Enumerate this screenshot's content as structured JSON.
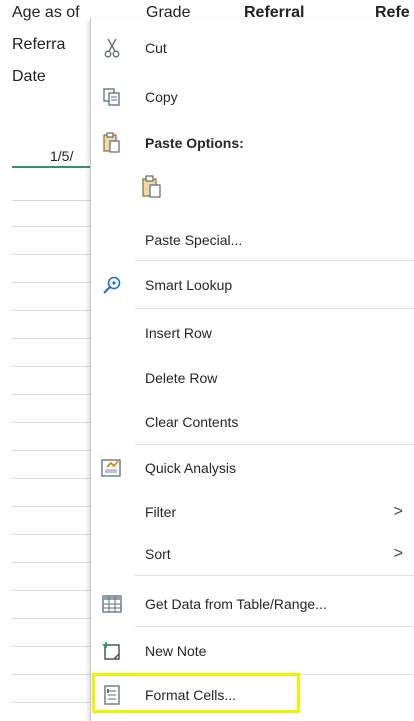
{
  "sheet": {
    "headers": {
      "col1_line1": "Age as of",
      "col1_line2": "Referra",
      "col1_line3": "Date",
      "grade": "Grade",
      "referral": "Referral",
      "referral2": "Refe"
    },
    "first_cell": "1/5/"
  },
  "menu": {
    "cut": "Cut",
    "copy": "Copy",
    "paste_options": "Paste Options:",
    "paste_special": "Paste Special...",
    "smart_lookup": "Smart Lookup",
    "insert_row": "Insert Row",
    "delete_row": "Delete Row",
    "clear_contents": "Clear Contents",
    "quick_analysis": "Quick Analysis",
    "filter": "Filter",
    "sort": "Sort",
    "get_data": "Get Data from Table/Range...",
    "new_note": "New Note",
    "format_cells": "Format Cells...",
    "submenu_arrow": ">"
  },
  "colors": {
    "highlight": "#f2f200",
    "selection_green": "#3e8e5a"
  }
}
